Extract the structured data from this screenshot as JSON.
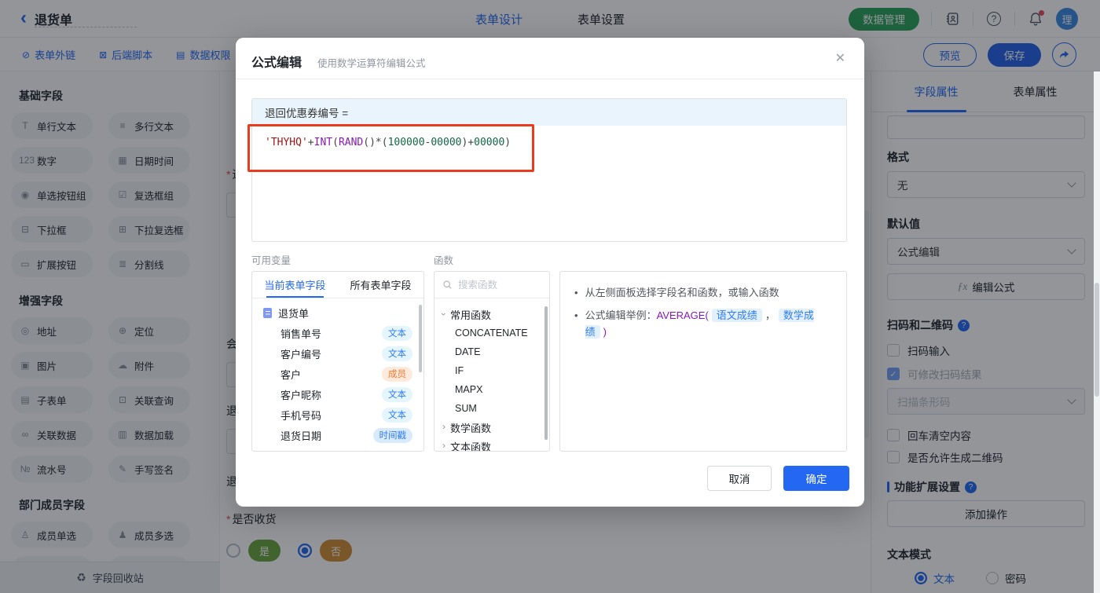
{
  "icons": {
    "question": "?"
  },
  "topbar": {
    "back_icon": "‹",
    "title": "退货单",
    "nav_tabs": [
      {
        "key": "form-design",
        "label": "表单设计",
        "active": true
      },
      {
        "key": "form-settings",
        "label": "表单设置",
        "active": false
      }
    ],
    "data_manage": "数据管理",
    "avatar": "理"
  },
  "toolbar": {
    "links": [
      {
        "key": "form-external-link",
        "icon": "⊘",
        "label": "表单外链"
      },
      {
        "key": "backend-script",
        "icon": "⊠",
        "label": "后端脚本"
      },
      {
        "key": "data-permission",
        "icon": "▤",
        "label": "数据权限"
      }
    ],
    "preview": "预览",
    "save": "保存"
  },
  "sidebar": {
    "sections": [
      {
        "title": "基础字段",
        "partial_extra": 0,
        "items": [
          {
            "key": "single-line-text",
            "icon": "T",
            "label": "单行文本"
          },
          {
            "key": "multi-line-text",
            "icon": "≡",
            "label": "多行文本"
          },
          {
            "key": "number",
            "icon": "123",
            "label": "数字"
          },
          {
            "key": "datetime",
            "icon": "▦",
            "label": "日期时间"
          },
          {
            "key": "radio-group",
            "icon": "◉",
            "label": "单选按钮组"
          },
          {
            "key": "checkbox-group",
            "icon": "☑",
            "label": "复选框组"
          },
          {
            "key": "dropdown",
            "icon": "⊟",
            "label": "下拉框"
          },
          {
            "key": "dropdown-multi",
            "icon": "⊞",
            "label": "下拉复选框"
          },
          {
            "key": "extend-button",
            "icon": "▭",
            "label": "扩展按钮"
          },
          {
            "key": "divider-line",
            "icon": "≣",
            "label": "分割线"
          }
        ]
      },
      {
        "title": "增强字段",
        "partial_extra": 0,
        "items": [
          {
            "key": "address",
            "icon": "◎",
            "label": "地址"
          },
          {
            "key": "location",
            "icon": "⊕",
            "label": "定位"
          },
          {
            "key": "image",
            "icon": "▣",
            "label": "图片"
          },
          {
            "key": "attachment",
            "icon": "☁",
            "label": "附件"
          },
          {
            "key": "subform",
            "icon": "▤",
            "label": "子表单"
          },
          {
            "key": "linked-query",
            "icon": "⊡",
            "label": "关联查询"
          },
          {
            "key": "linked-data",
            "icon": "∞",
            "label": "关联数据"
          },
          {
            "key": "data-load",
            "icon": "▥",
            "label": "数据加载"
          },
          {
            "key": "serial-number",
            "icon": "№",
            "label": "流水号"
          },
          {
            "key": "signature",
            "icon": "✎",
            "label": "手写签名"
          }
        ]
      },
      {
        "title": "部门成员字段",
        "partial_extra": 2,
        "items": [
          {
            "key": "member-single",
            "icon": "♙",
            "label": "成员单选"
          },
          {
            "key": "member-multi",
            "icon": "♟",
            "label": "成员多选"
          }
        ]
      }
    ],
    "recycle_icon": "♻",
    "recycle": "字段回收站"
  },
  "canvas": {
    "required_mark": "*",
    "partials": [
      {
        "label": "退",
        "required": true,
        "input": true
      },
      {
        "label": "会",
        "required": false,
        "input": true
      },
      {
        "label": "退",
        "required": false,
        "input": true
      },
      {
        "label": "退",
        "required": false,
        "input": false
      }
    ],
    "receive": {
      "label": "是否收货",
      "required": true,
      "options": [
        {
          "key": "yes",
          "label": "是",
          "color": "green",
          "selected": false
        },
        {
          "key": "no",
          "label": "否",
          "color": "orange",
          "selected": true
        }
      ]
    }
  },
  "modal": {
    "title": "公式编辑",
    "subtitle": "使用数学运算符编辑公式",
    "close_icon": "✕",
    "target": "退回优惠券编号 =",
    "formula_tokens": [
      {
        "t": "'THYHQ'",
        "c": "str"
      },
      {
        "t": "+",
        "c": "op"
      },
      {
        "t": "INT",
        "c": "fn"
      },
      {
        "t": "(",
        "c": "op"
      },
      {
        "t": "RAND",
        "c": "fn"
      },
      {
        "t": "()*(",
        "c": "op"
      },
      {
        "t": "100000",
        "c": "num"
      },
      {
        "t": "-",
        "c": "op"
      },
      {
        "t": "00000",
        "c": "num"
      },
      {
        "t": ")",
        "c": "op"
      },
      {
        "t": "+",
        "c": "op"
      },
      {
        "t": "00000",
        "c": "num"
      },
      {
        "t": ")",
        "c": "op"
      }
    ],
    "variables_label": "可用变量",
    "variables": {
      "tabs": [
        {
          "key": "current-form-fields",
          "label": "当前表单字段",
          "active": true
        },
        {
          "key": "all-form-fields",
          "label": "所有表单字段",
          "active": false
        }
      ],
      "root": "退货单",
      "fields": [
        {
          "key": "sales-order-no",
          "name": "销售单号",
          "badge": "文本",
          "type": "text"
        },
        {
          "key": "customer-no",
          "name": "客户编号",
          "badge": "文本",
          "type": "text"
        },
        {
          "key": "customer",
          "name": "客户",
          "badge": "成员",
          "type": "member"
        },
        {
          "key": "customer-nickname",
          "name": "客户昵称",
          "badge": "文本",
          "type": "text"
        },
        {
          "key": "phone-number",
          "name": "手机号码",
          "badge": "文本",
          "type": "text"
        },
        {
          "key": "return-date",
          "name": "退货日期",
          "badge": "时间戳",
          "type": "timestamp"
        }
      ]
    },
    "functions_label": "函数",
    "functions": {
      "search_placeholder": "搜索函数",
      "groups": [
        {
          "key": "common-functions",
          "label": "常用函数",
          "expanded": true,
          "items": [
            "CONCATENATE",
            "DATE",
            "IF",
            "MAPX",
            "SUM"
          ]
        },
        {
          "key": "math-functions",
          "label": "数学函数",
          "expanded": false,
          "items": []
        },
        {
          "key": "text-functions",
          "label": "文本函数",
          "expanded": false,
          "items": []
        }
      ]
    },
    "tips": [
      {
        "segments": [
          {
            "t": "从左侧面板选择字段名和函数，或输入函数",
            "c": "plain"
          }
        ]
      },
      {
        "segments": [
          {
            "t": "公式编辑举例：",
            "c": "plain"
          },
          {
            "t": "AVERAGE(",
            "c": "fn"
          },
          {
            "t": "语文成绩",
            "c": "chip"
          },
          {
            "t": "，",
            "c": "plain"
          },
          {
            "t": "数学成绩",
            "c": "chip"
          },
          {
            "t": ")",
            "c": "fn"
          }
        ]
      }
    ],
    "cancel": "取消",
    "confirm": "确定"
  },
  "right_panel": {
    "tabs": [
      {
        "key": "field-props",
        "label": "字段属性",
        "active": true
      },
      {
        "key": "form-props",
        "label": "表单属性",
        "active": false
      }
    ],
    "format_label": "格式",
    "format_value": "无",
    "default_label": "默认值",
    "default_value": "公式编辑",
    "fx": "ƒx",
    "edit_formula": "编辑公式",
    "scan_section": "扫码和二维码",
    "checks_top": [
      {
        "key": "scan-input",
        "label": "扫码输入",
        "checked": false,
        "disabled": false
      },
      {
        "key": "scan-result-editable",
        "label": "可修改扫码结果",
        "checked": true,
        "disabled": true
      }
    ],
    "scan_select": "扫描条形码",
    "checks_bottom": [
      {
        "key": "enter-clear",
        "label": "回车清空内容",
        "checked": false,
        "disabled": false
      },
      {
        "key": "allow-qrcode",
        "label": "是否允许生成二维码",
        "checked": false,
        "disabled": false
      }
    ],
    "ext_section": "功能扩展设置",
    "add_action": "添加操作",
    "text_mode_label": "文本模式",
    "radios": [
      {
        "key": "text",
        "label": "文本",
        "selected": true
      },
      {
        "key": "password",
        "label": "密码",
        "selected": false
      }
    ],
    "check_mark": "✓"
  },
  "colors": {
    "primary": "#2468f2",
    "green": "#2aa158",
    "annotation_red": "#e93b1d"
  }
}
